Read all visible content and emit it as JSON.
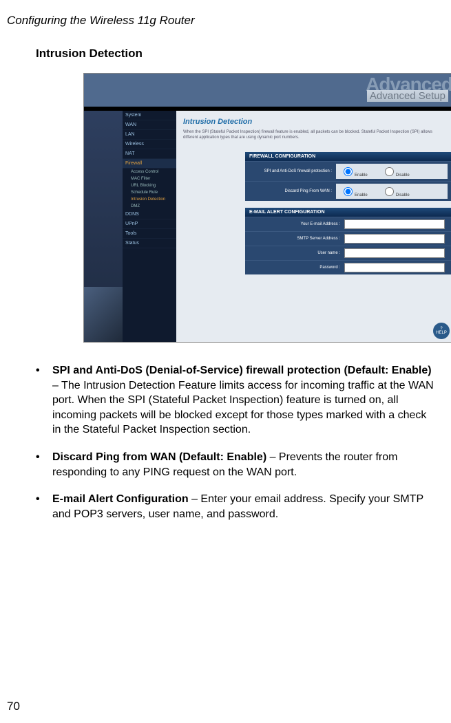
{
  "header": "Configuring the Wireless 11g Router",
  "section_title": "Intrusion Detection",
  "page_number": "70",
  "screenshot": {
    "ghost_text": "Advanced",
    "banner_label": "Advanced Setup",
    "home_icon_name": "home-icon",
    "nav": {
      "items": [
        "System",
        "WAN",
        "LAN",
        "Wireless",
        "NAT",
        "Firewall",
        "DDNS",
        "UPnP",
        "Tools",
        "Status"
      ],
      "current": "Firewall",
      "subitems": [
        "Access Control",
        "MAC Filter",
        "URL Blocking",
        "Schedule Rule",
        "Intrusion Detection",
        "DMZ"
      ],
      "sub_active": "Intrusion Detection"
    },
    "main": {
      "title": "Intrusion Detection",
      "desc": "When the SPI (Stateful Packet Inspection) firewall feature is enabled, all packets can be blocked.  Stateful Packet Inspection (SPI) allows different application types that are using dynamic port numbers.",
      "firewall_header": "FIREWALL CONFIGURATION",
      "row1_label": "SPI and Anti-DoS firewall protection :",
      "row2_label": "Discard Ping From WAN :",
      "radio_enable": "Enable",
      "radio_disable": "Disable",
      "email_header": "E-MAIL ALERT CONFIGURATION",
      "email_rows": {
        "r1": "Your E-mail Address :",
        "r2": "SMTP Server Address :",
        "r3": "User name :",
        "r4": "Password :"
      }
    },
    "help_label": "HELP"
  },
  "bullets": {
    "b1_bold": "SPI and Anti-DoS (Denial-of-Service) firewall protection (Default: Enable)",
    "b1_rest": " – The Intrusion Detection Feature limits access for incoming traffic at the WAN port. When the SPI (Stateful Packet Inspection) feature is turned on, all incoming packets will be blocked except for those types marked with a check in the Stateful Packet Inspection section.",
    "b2_bold": "Discard Ping from WAN (Default: Enable)",
    "b2_rest": " – Prevents the router from responding to any PING request on the WAN port.",
    "b3_bold": "E-mail Alert Configuration",
    "b3_rest": " – Enter your email address. Specify your SMTP and POP3 servers, user name, and password."
  }
}
